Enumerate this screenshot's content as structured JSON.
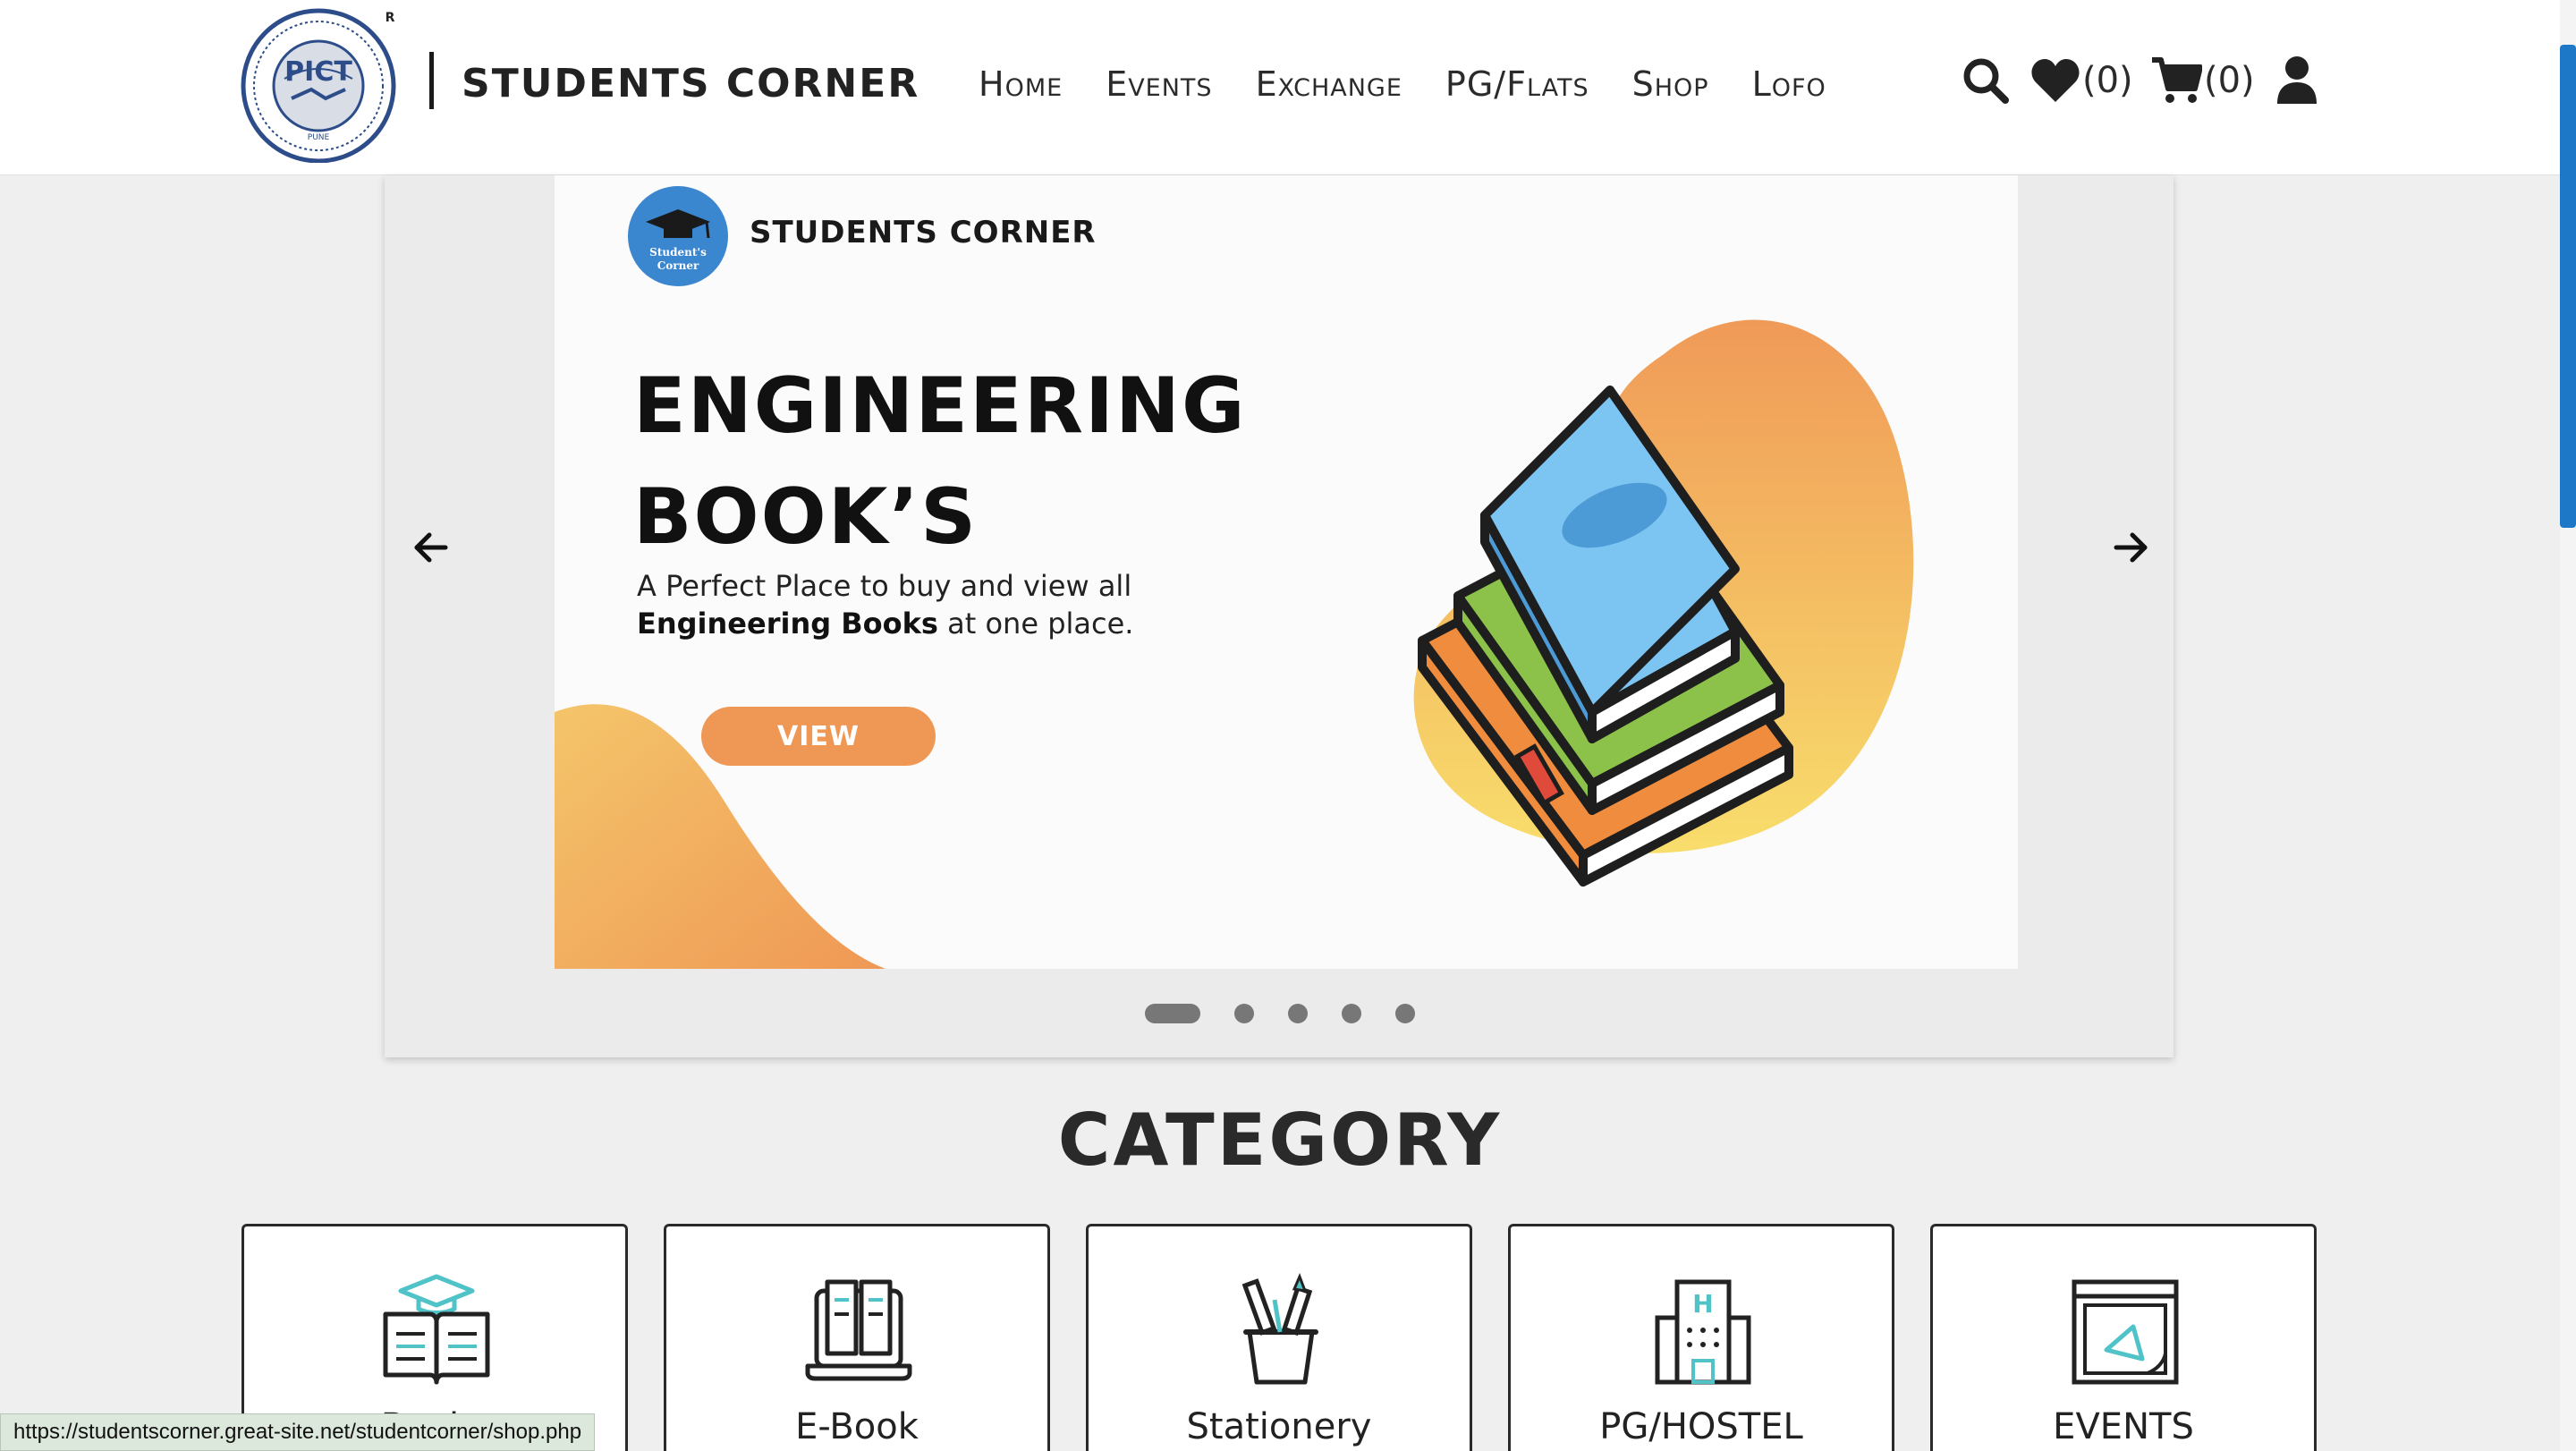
{
  "header": {
    "logo_text": "PICT",
    "logo_ring_text": "SOCIETY FOR COMPUTER TECHNOLOGY AND RESEARCH",
    "logo_city": "PUNE",
    "logo_registered": "R",
    "brand": "STUDENTS CORNER",
    "nav": [
      "Home",
      "Events",
      "Exchange",
      "PG/Flats",
      "Shop",
      "Lofo"
    ],
    "wishlist_count": "(0)",
    "cart_count": "(0)",
    "icons": [
      "search-icon",
      "heart-icon",
      "cart-icon",
      "user-icon"
    ]
  },
  "carousel": {
    "slide": {
      "logo_text": "Student's Corner",
      "brand": "STUDENTS CORNER",
      "headline_line1": "ENGINEERING",
      "headline_line2": "BOOK’S",
      "desc_line1": "A Perfect Place to buy and view all",
      "desc_bold": "Engineering Books",
      "desc_rest": " at one place.",
      "button": "VIEW"
    },
    "dots_total": 5,
    "active_dot": 1,
    "accent": "#ef9855"
  },
  "category": {
    "title": "CATEGORY",
    "items": [
      {
        "label": "Books",
        "icon": "book-graduation-icon"
      },
      {
        "label": "E-Book",
        "icon": "ebook-icon"
      },
      {
        "label": "Stationery",
        "icon": "stationery-icon"
      },
      {
        "label": "PG/HOSTEL",
        "icon": "hostel-icon"
      },
      {
        "label": "EVENTS",
        "icon": "events-icon"
      }
    ]
  },
  "status_url": "https://studentscorner.great-site.net/studentcorner/shop.php"
}
